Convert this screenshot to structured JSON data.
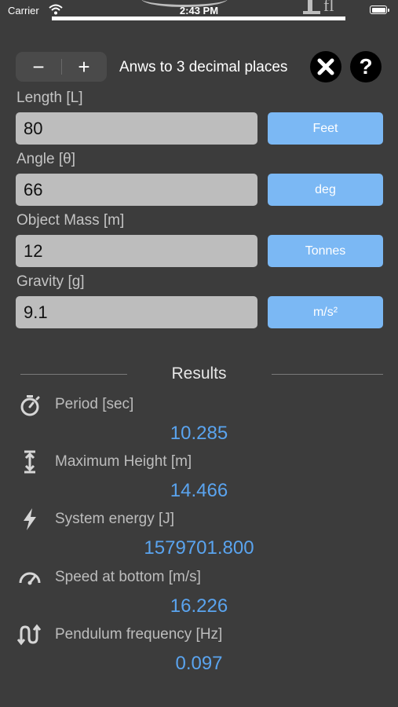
{
  "status_bar": {
    "carrier": "Carrier",
    "time": "2:43 PM"
  },
  "precision": {
    "decrement_label": "−",
    "increment_label": "+",
    "text": "Anws to 3 decimal places"
  },
  "inputs": [
    {
      "label": "Length [L]",
      "value": "80",
      "unit": "Feet"
    },
    {
      "label": "Angle [θ]",
      "value": "66",
      "unit": "deg"
    },
    {
      "label": "Object Mass [m]",
      "value": "12",
      "unit": "Tonnes"
    },
    {
      "label": "Gravity [g]",
      "value": "9.1",
      "unit": "m/s²"
    }
  ],
  "results": {
    "title": "Results",
    "items": [
      {
        "icon": "stopwatch-icon",
        "label": "Period [sec]",
        "value": "10.285"
      },
      {
        "icon": "height-icon",
        "label": "Maximum Height [m]",
        "value": "14.466"
      },
      {
        "icon": "lightning-icon",
        "label": "System energy [J]",
        "value": "1579701.800"
      },
      {
        "icon": "speedometer-icon",
        "label": "Speed at bottom [m/s]",
        "value": "16.226"
      },
      {
        "icon": "frequency-icon",
        "label": "Pendulum frequency [Hz]",
        "value": "0.097"
      }
    ]
  },
  "colors": {
    "background": "#3c3c3c",
    "input_background": "#bdbdbd",
    "unit_button": "#7bb8f4",
    "result_value": "#5aa4ef"
  }
}
